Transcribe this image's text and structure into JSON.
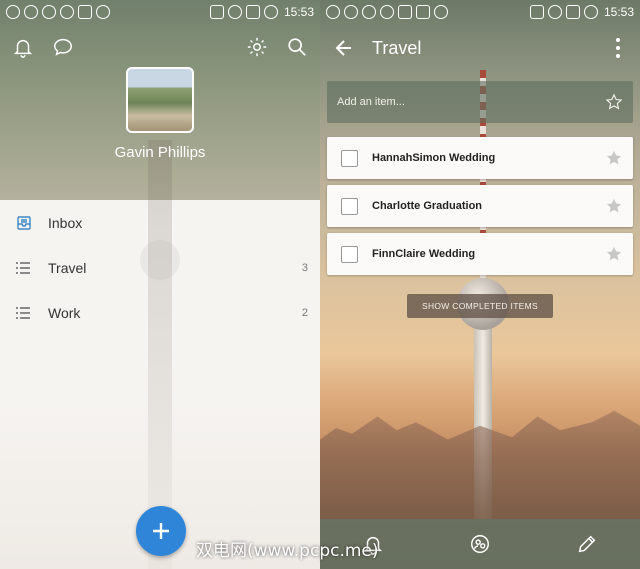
{
  "status_bar": {
    "time": "15:53"
  },
  "left_panel": {
    "user_name": "Gavin Phillips",
    "lists": [
      {
        "label": "Inbox",
        "count": ""
      },
      {
        "label": "Travel",
        "count": "3"
      },
      {
        "label": "Work",
        "count": "2"
      }
    ],
    "fab_label": "+"
  },
  "right_panel": {
    "title": "Travel",
    "add_item_placeholder": "Add an item...",
    "tasks": [
      {
        "label": "HannahSimon Wedding"
      },
      {
        "label": "Charlotte Graduation"
      },
      {
        "label": "FinnClaire Wedding"
      }
    ],
    "show_completed_label": "SHOW COMPLETED ITEMS"
  },
  "watermark": "双电网(www.pcpc.me)",
  "colors": {
    "accent": "#2f86d8",
    "list_bg": "#f6f4f1"
  },
  "icons": {
    "left_header": [
      "bell-icon",
      "chat-icon",
      "gear-icon",
      "search-icon"
    ],
    "list_items": [
      "inbox-icon",
      "list-icon",
      "list-icon"
    ],
    "right_bottom": [
      "bell-icon",
      "share-icon",
      "pencil-icon"
    ]
  }
}
